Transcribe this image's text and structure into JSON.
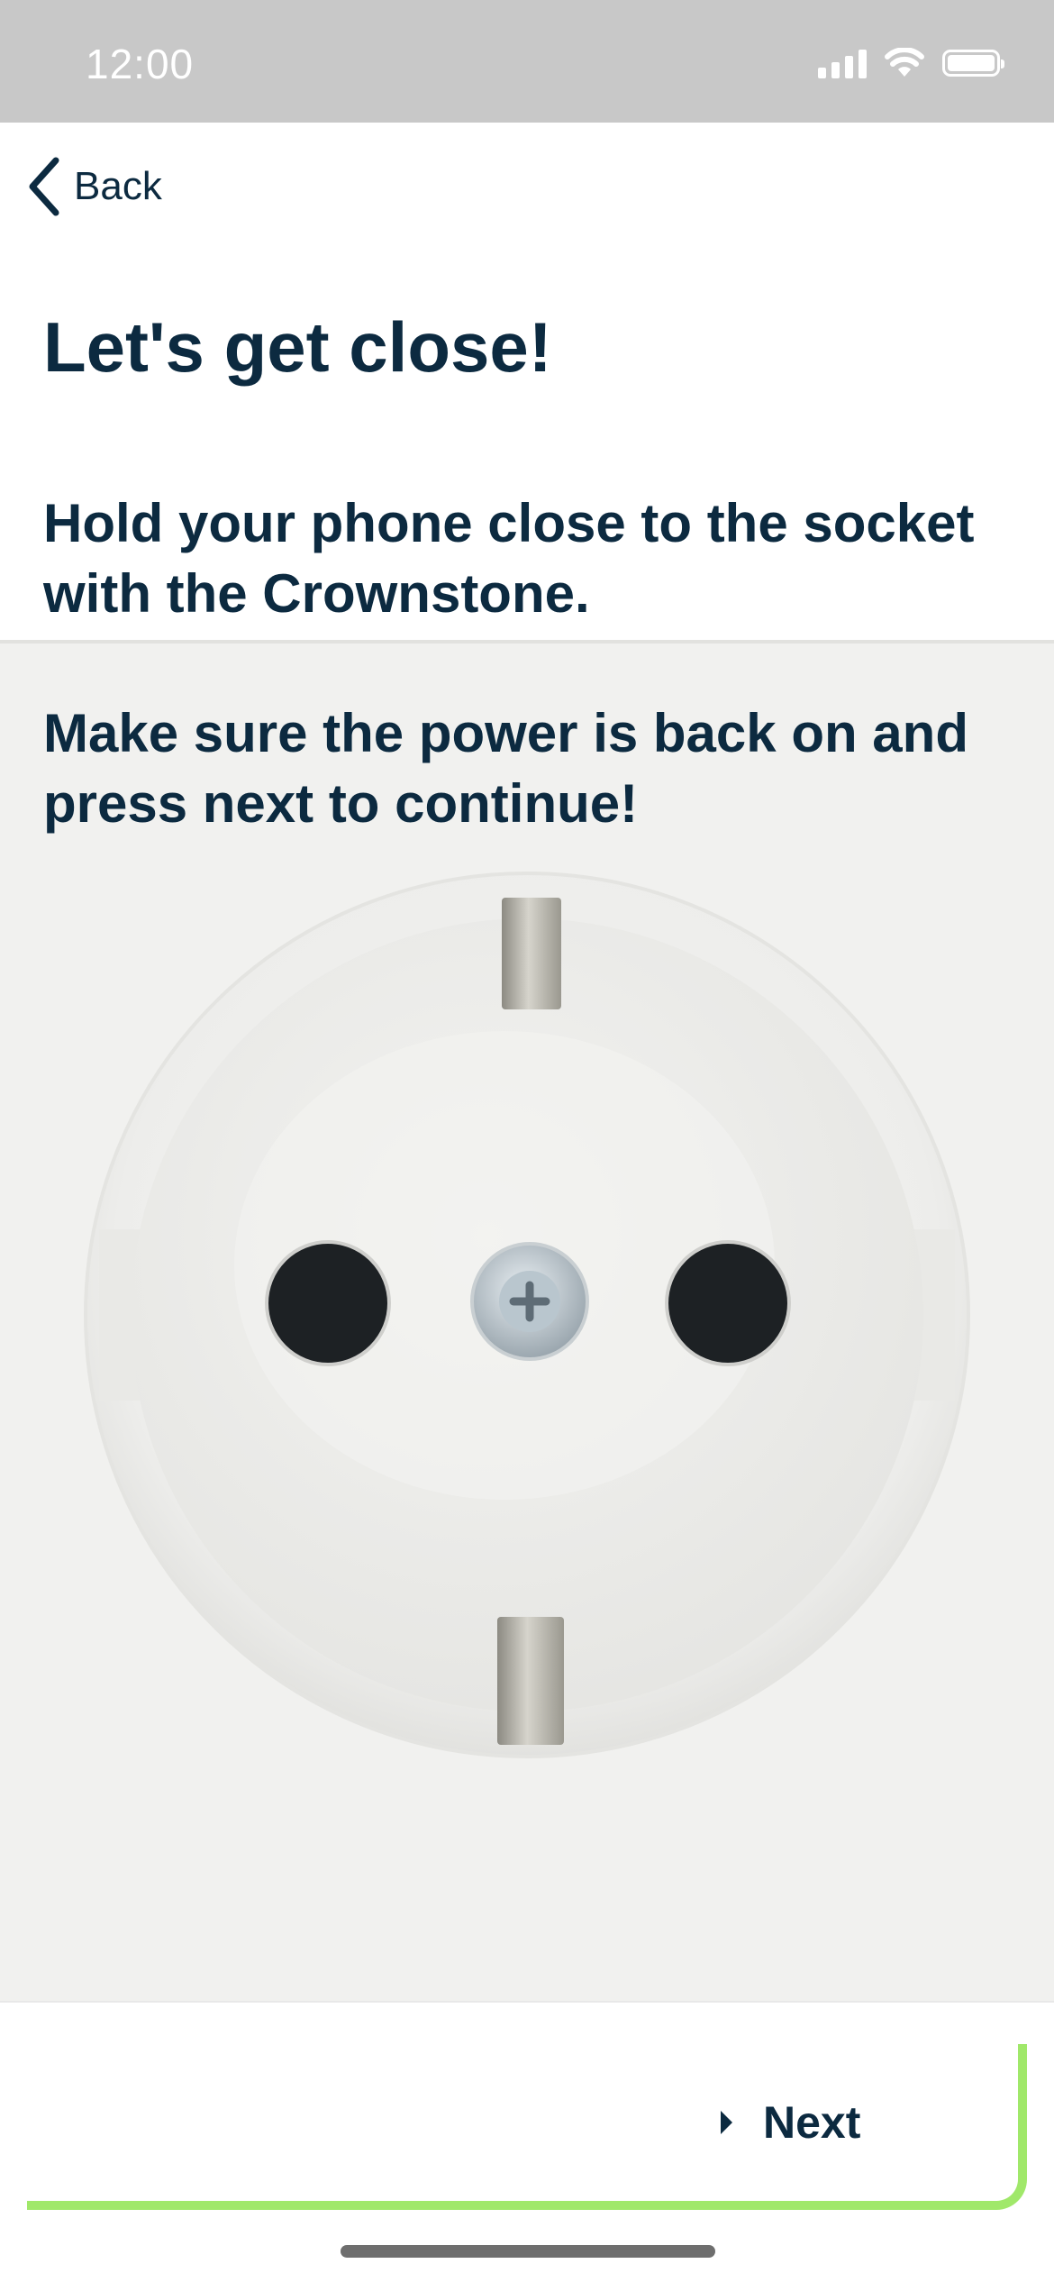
{
  "status_bar": {
    "time": "12:00",
    "icons": [
      "signal-icon",
      "wifi-icon",
      "battery-icon"
    ]
  },
  "nav": {
    "back_label": "Back",
    "back_icon": "chevron-left-icon"
  },
  "content": {
    "title": "Let's get close!",
    "instruction_1": "Hold your phone close to the socket with the Crownstone.",
    "instruction_2": "Make sure the power is back on and press next to continue!"
  },
  "footer": {
    "next_label": "Next",
    "next_icon": "play-arrow-icon",
    "accent_color": "#a0e86a"
  },
  "colors": {
    "text": "#0c2a40",
    "status_bar": "#c8c8c8",
    "photo_background": "#f1f1ef"
  },
  "illustration": "power-socket-photo"
}
